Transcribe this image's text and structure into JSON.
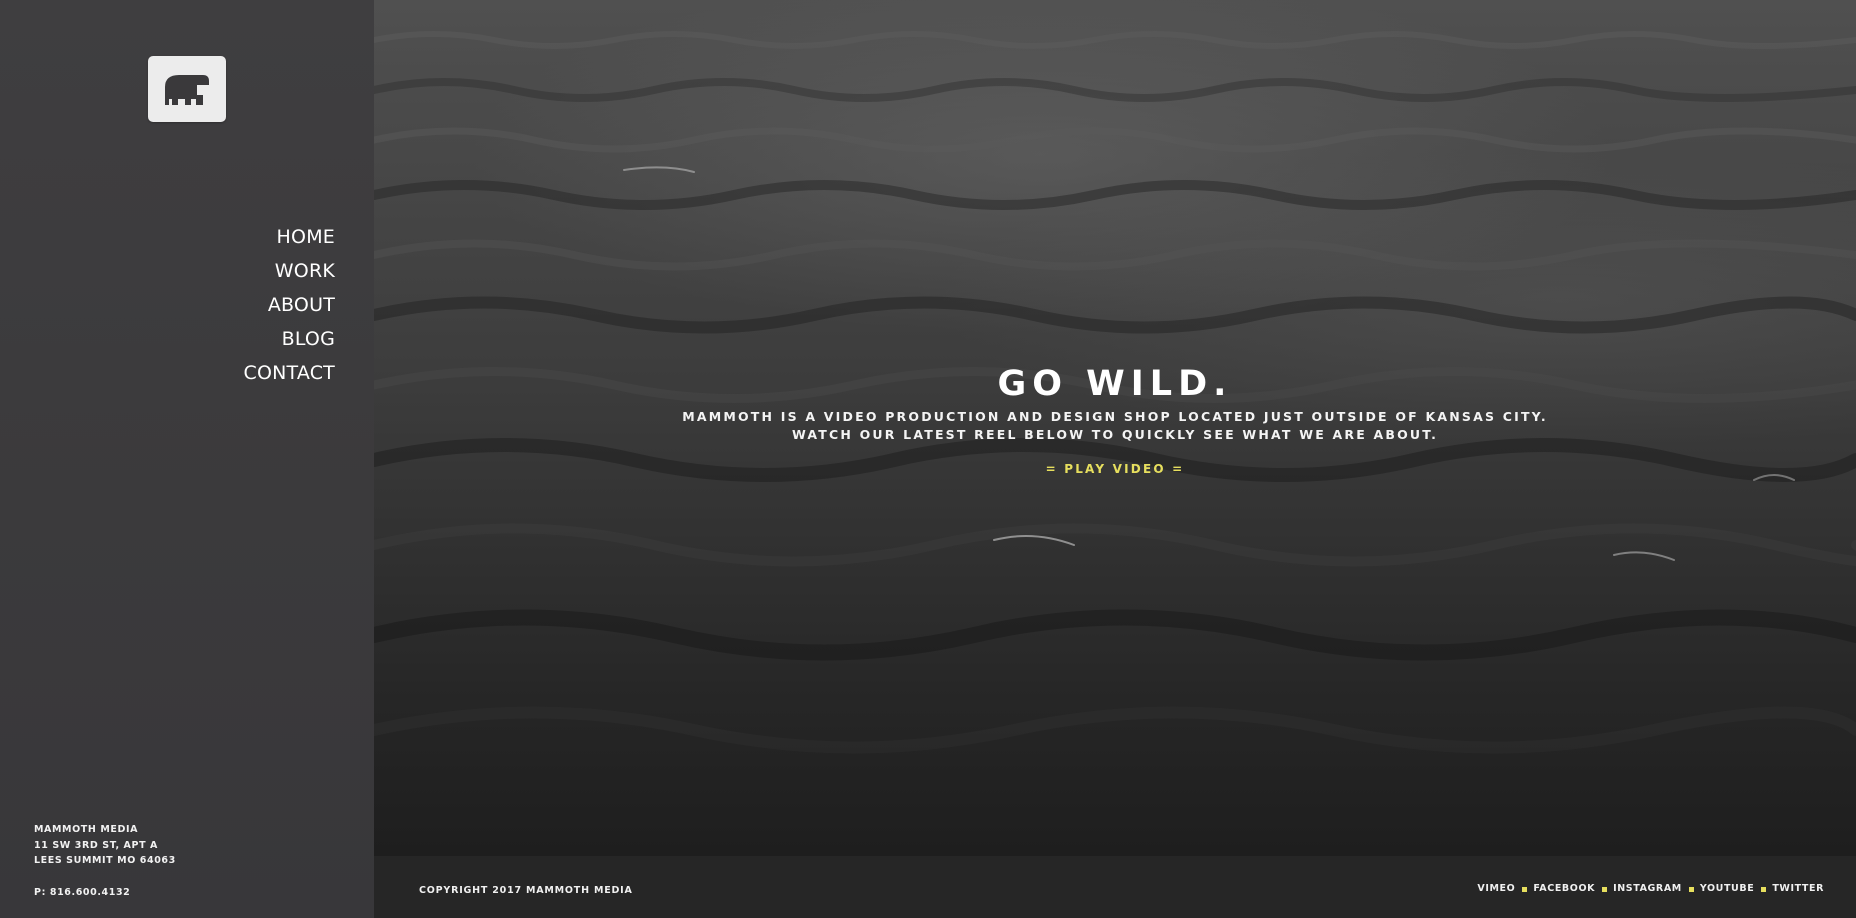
{
  "brand": {
    "logo_icon": "elephant-logo-icon"
  },
  "nav": {
    "items": [
      {
        "label": "HOME"
      },
      {
        "label": "WORK"
      },
      {
        "label": "ABOUT"
      },
      {
        "label": "BLOG"
      },
      {
        "label": "CONTACT"
      }
    ]
  },
  "address": {
    "company": "MAMMOTH MEDIA",
    "street": "11 SW 3RD ST, APT A",
    "city": "LEES SUMMIT MO 64063",
    "phone": "P: 816.600.4132"
  },
  "hero": {
    "headline": "GO WILD.",
    "line1": "MAMMOTH IS A VIDEO PRODUCTION AND DESIGN SHOP LOCATED JUST OUTSIDE OF KANSAS CITY.",
    "line2": "WATCH OUR LATEST REEL BELOW TO QUICKLY SEE WHAT WE ARE ABOUT.",
    "cta": "= PLAY VIDEO ="
  },
  "footer": {
    "copyright": "COPYRIGHT 2017 MAMMOTH MEDIA",
    "social": [
      {
        "label": "VIMEO"
      },
      {
        "label": "FACEBOOK"
      },
      {
        "label": "INSTAGRAM"
      },
      {
        "label": "YOUTUBE"
      },
      {
        "label": "TWITTER"
      }
    ]
  },
  "colors": {
    "accent": "#e7df5e",
    "sidebar": "#3d3c3e",
    "footer": "#262626"
  }
}
